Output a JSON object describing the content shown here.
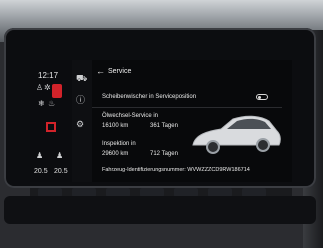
{
  "status": {
    "time": "12:17"
  },
  "climate": {
    "left_temp": "20.5",
    "right_temp": "20.5"
  },
  "header": {
    "title": "Service",
    "back_glyph": "←"
  },
  "rows": {
    "wiper_label": "Scheibenwischer in Serviceposition",
    "oil_title": "Ölwechsel-Service in",
    "oil_km": "16100 km",
    "oil_days": "361 Tagen",
    "insp_title": "Inspektion in",
    "insp_km": "29600 km",
    "insp_days": "712 Tagen",
    "vin": "Fahrzeug-Identifizierungsnummer: WVWZZZCD9RW186714"
  },
  "icons": {
    "car": "car-icon",
    "info": "info-icon",
    "settings": "gear-icon"
  },
  "colors": {
    "accent": "#d2232a"
  }
}
